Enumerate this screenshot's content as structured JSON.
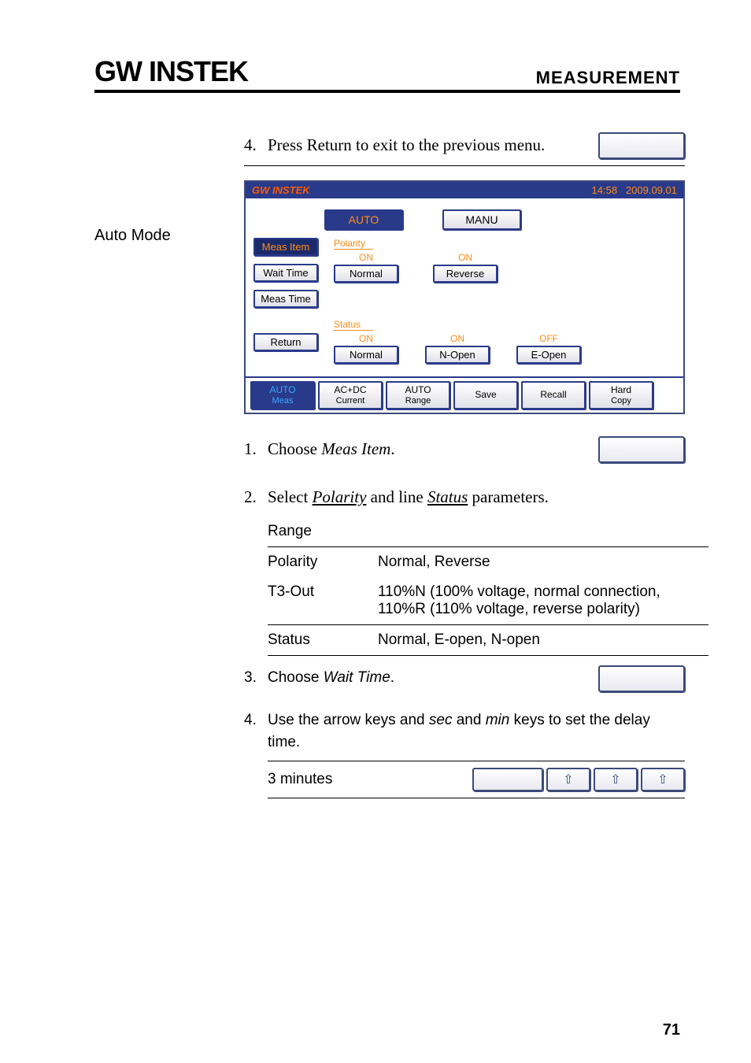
{
  "header": {
    "logo": "GW INSTEK",
    "sectionTitle": "MEASUREMENT"
  },
  "step4": {
    "num": "4.",
    "text": "Press Return to exit to the previous menu."
  },
  "leftLabel": "Auto Mode",
  "device": {
    "brand": "GW INSTEK",
    "time": "14:58",
    "date": "2009.09.01",
    "tabs": {
      "auto": "AUTO",
      "manu": "MANU"
    },
    "side": {
      "measItem": "Meas Item",
      "waitTime": "Wait Time",
      "measTime": "Meas Time",
      "return": "Return"
    },
    "polarity": {
      "label": "Polarity",
      "c1top": "ON",
      "c1bot": "Normal",
      "c2top": "ON",
      "c2bot": "Reverse"
    },
    "status": {
      "label": "Status",
      "c1top": "ON",
      "c1bot": "Normal",
      "c2top": "ON",
      "c2bot": "N-Open",
      "c3top": "OFF",
      "c3bot": "E-Open"
    },
    "bottom": {
      "b1a": "AUTO",
      "b1b": "Meas",
      "b2a": "AC+DC",
      "b2b": "Current",
      "b3a": "AUTO",
      "b3b": "Range",
      "b4": "Save",
      "b5": "Recall",
      "b6a": "Hard",
      "b6b": "Copy"
    }
  },
  "step1": {
    "num": "1.",
    "pre": "Choose ",
    "em": "Meas Item",
    "post": "."
  },
  "step2": {
    "num": "2.",
    "pre": "Select ",
    "u1": "Polarity",
    "mid": " and line ",
    "u2": "Status",
    "post": " parameters."
  },
  "table": {
    "rangeLabel": "Range",
    "rows": [
      {
        "k": "Polarity",
        "v": "Normal, Reverse"
      },
      {
        "k": "T3-Out",
        "v": "110%N (100% voltage, normal connection, 110%R  (110% voltage, reverse polarity)"
      },
      {
        "k": "Status",
        "v": "Normal, E-open, N-open"
      }
    ]
  },
  "step3": {
    "num": "3.",
    "pre": "Choose ",
    "em": "Wait Time",
    "post": "."
  },
  "step4b": {
    "num": "4.",
    "pre": "Use the arrow keys and ",
    "em1": "sec",
    "mid": " and ",
    "em2": "min",
    "post": " keys to set the delay time."
  },
  "delayRow": {
    "label": "3 minutes"
  },
  "pageNumber": "71"
}
